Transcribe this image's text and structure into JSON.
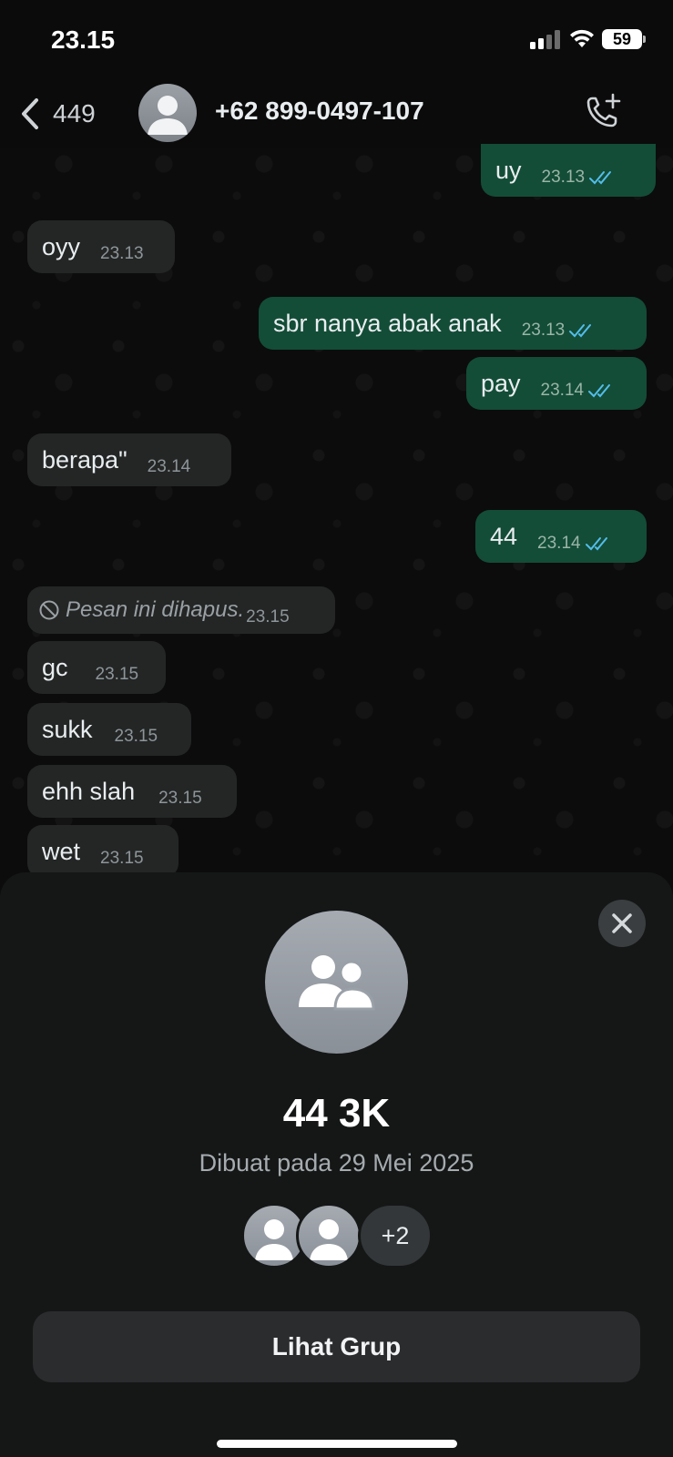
{
  "status_bar": {
    "time": "23.15",
    "battery": "59"
  },
  "header": {
    "back_count": "449",
    "contact_name": "+62 899-0497-107"
  },
  "messages": [
    {
      "text": "uy",
      "time": "23.13",
      "direction": "out",
      "status": "read"
    },
    {
      "text": "oyy",
      "time": "23.13",
      "direction": "in"
    },
    {
      "text": "sbr nanya abak anak",
      "time": "23.13",
      "direction": "out",
      "status": "read"
    },
    {
      "text": "pay",
      "time": "23.14",
      "direction": "out",
      "status": "read"
    },
    {
      "text": "berapa\"",
      "time": "23.14",
      "direction": "in"
    },
    {
      "text": "44",
      "time": "23.14",
      "direction": "out",
      "status": "read"
    },
    {
      "text": "Pesan ini dihapus.",
      "time": "23.15",
      "direction": "in",
      "deleted": true
    },
    {
      "text": "gc",
      "time": "23.15",
      "direction": "in"
    },
    {
      "text": "sukk",
      "time": "23.15",
      "direction": "in"
    },
    {
      "text": "ehh slah",
      "time": "23.15",
      "direction": "in"
    },
    {
      "text": "wet",
      "time": "23.15",
      "direction": "in"
    }
  ],
  "group_sheet": {
    "title": "44 3K",
    "subtitle": "Dibuat pada 29 Mei 2025",
    "more_members": "+2",
    "view_button": "Lihat Grup"
  },
  "colors": {
    "incoming_bubble": "#242626",
    "outgoing_bubble": "#134d37",
    "read_ticks": "#53bdeb",
    "sheet_bg": "#151717"
  }
}
